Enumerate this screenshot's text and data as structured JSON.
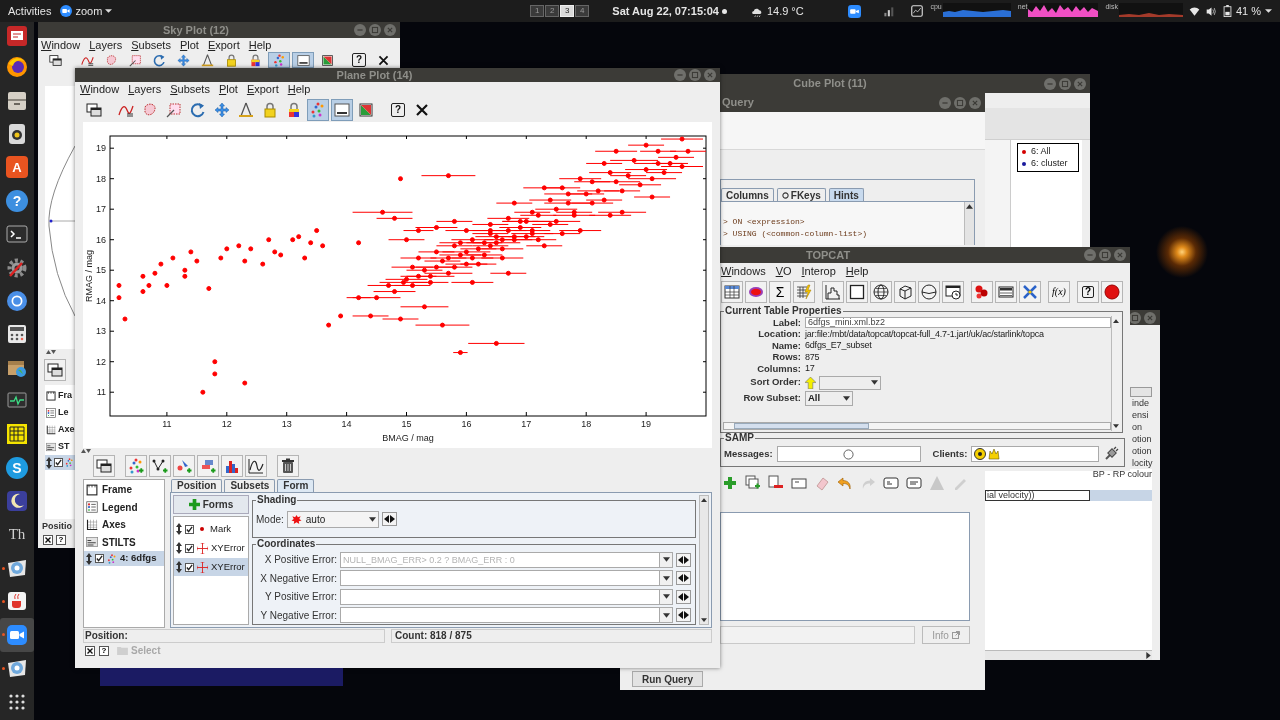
{
  "top_bar": {
    "activities": "Activities",
    "app_menu": "zoom",
    "workspaces": [
      {
        "label": "1",
        "selected": false
      },
      {
        "label": "2",
        "selected": false
      },
      {
        "label": "3",
        "selected": true
      },
      {
        "label": "4",
        "selected": false
      }
    ],
    "clock": "Sat Aug 22, 07:15:04",
    "weather": "14.9 °C",
    "monitors": [
      {
        "label": "cpu",
        "kind": "cpu"
      },
      {
        "label": "net",
        "kind": "net"
      },
      {
        "label": "disk",
        "kind": "disk"
      }
    ],
    "battery": "41 %"
  },
  "dock": {
    "items": [
      {
        "kind": "red-app",
        "running": false,
        "selected": false
      },
      {
        "kind": "browser",
        "running": false,
        "selected": false
      },
      {
        "kind": "files",
        "running": false,
        "selected": false
      },
      {
        "kind": "media",
        "running": false,
        "selected": false
      },
      {
        "kind": "store",
        "glyph": "A",
        "running": false,
        "selected": false
      },
      {
        "kind": "help",
        "glyph": "?",
        "running": false,
        "selected": false
      },
      {
        "kind": "terminal",
        "running": false,
        "selected": false
      },
      {
        "kind": "settings",
        "running": false,
        "selected": false
      },
      {
        "kind": "ring",
        "running": false,
        "selected": false
      },
      {
        "kind": "calculator",
        "running": false,
        "selected": false
      },
      {
        "kind": "package",
        "running": false,
        "selected": false
      },
      {
        "kind": "monitor",
        "running": false,
        "selected": false
      },
      {
        "kind": "grid",
        "running": false,
        "selected": false
      },
      {
        "kind": "chat",
        "glyph": "S",
        "running": false,
        "selected": false
      },
      {
        "kind": "night",
        "running": false,
        "selected": false
      },
      {
        "kind": "glyph",
        "glyph": "Th",
        "running": false,
        "selected": false
      },
      {
        "kind": "disc",
        "running": true,
        "selected": false
      },
      {
        "kind": "cup",
        "running": true,
        "selected": false
      },
      {
        "kind": "video",
        "running": true,
        "selected": true
      },
      {
        "kind": "disc",
        "running": true,
        "selected": false
      },
      {
        "kind": "apps",
        "running": false,
        "selected": false
      }
    ]
  },
  "cube_plot": {
    "title": "Cube Plot (11)",
    "legend": [
      {
        "label": "6: All",
        "color": "#d40000"
      },
      {
        "label": "6: cluster",
        "color": "#1a1a9c"
      }
    ]
  },
  "query_window": {
    "title": "Query",
    "tabs": [
      {
        "label": "Columns",
        "kind": "plain",
        "selected": false
      },
      {
        "label": "FKeys",
        "kind": "key",
        "selected": false
      },
      {
        "label": "Hints",
        "kind": "plain",
        "selected": true
      }
    ],
    "hints": [
      "> ON <expression>",
      "> USING (<common-column-list>)"
    ],
    "info_button": {
      "label": "Info",
      "disabled": true
    },
    "run_button": "Run Query"
  },
  "columns_window": {
    "cells": [
      "inde",
      "ensi",
      "on",
      "otion",
      "otion",
      "locity"
    ],
    "rows": [
      {
        "column_2": "BP - RP colour",
        "selected": false
      },
      {
        "column_1": "ial velocity))",
        "selected": true
      }
    ]
  },
  "topcat": {
    "title": "TOPCAT",
    "menu": [
      "Windows",
      "VO",
      "Interop",
      "Help"
    ],
    "toolbar": [
      {
        "kind": "table"
      },
      {
        "kind": "ellipse"
      },
      {
        "kind": "sigma",
        "glyph": "Σ"
      },
      {
        "kind": "tablebolt"
      },
      {
        "kind": "histogram"
      },
      {
        "kind": "plane"
      },
      {
        "kind": "globe"
      },
      {
        "kind": "cube"
      },
      {
        "kind": "sphere"
      },
      {
        "kind": "time"
      },
      {
        "kind": "balls"
      },
      {
        "kind": "select"
      },
      {
        "kind": "cross"
      },
      {
        "kind": "fx",
        "glyph": "f(x)"
      },
      {
        "kind": "help",
        "glyph": "?"
      },
      {
        "kind": "stop"
      }
    ],
    "properties": {
      "title": "Current Table Properties",
      "rows": [
        {
          "label": "Label:",
          "value": "6dfgs_mini.xml.bz2",
          "kind": "field"
        },
        {
          "label": "Location:",
          "value": "jar:file:/mbt/data/topcat/topcat-full_4.7-1.jar!/uk/ac/starlink/topca",
          "kind": "text"
        },
        {
          "label": "Name:",
          "value": "6dfgs_E7_subset",
          "kind": "text"
        },
        {
          "label": "Rows:",
          "value": "875",
          "kind": "text"
        },
        {
          "label": "Columns:",
          "value": "17",
          "kind": "text"
        },
        {
          "label": "Sort Order:",
          "kind": "sort"
        },
        {
          "label": "Row Subset:",
          "value": "All",
          "kind": "select"
        }
      ]
    },
    "samp": {
      "title": "SAMP",
      "messages_label": "Messages:",
      "clients_label": "Clients:"
    }
  },
  "sky_plot": {
    "title": "Sky Plot (12)",
    "menu": [
      "Window",
      "Layers",
      "Subsets",
      "Plot",
      "Export",
      "Help"
    ],
    "toolbar": [
      {
        "kind": "window",
        "pressed": false
      },
      {
        "kind": "curve",
        "pressed": false
      },
      {
        "kind": "blob",
        "pressed": false
      },
      {
        "kind": "zoombox",
        "pressed": false
      },
      {
        "kind": "refresh",
        "pressed": false
      },
      {
        "kind": "move",
        "pressed": false
      },
      {
        "kind": "compass",
        "pressed": false
      },
      {
        "kind": "lock",
        "pressed": false
      },
      {
        "kind": "lockc",
        "pressed": false
      },
      {
        "kind": "dots",
        "pressed": true
      },
      {
        "kind": "bar",
        "pressed": true
      },
      {
        "kind": "image",
        "pressed": false
      },
      {
        "kind": "help",
        "glyph": "?",
        "pressed": false
      },
      {
        "kind": "close",
        "pressed": false
      }
    ],
    "controls": [
      {
        "label": "Fra",
        "kind": "frame"
      },
      {
        "label": "Le",
        "kind": "legend"
      },
      {
        "label": "Axe",
        "kind": "axes"
      },
      {
        "label": "ST",
        "kind": "stilts"
      }
    ],
    "layer": {
      "checked": true,
      "selected": true
    },
    "status": "Positio"
  },
  "plane_plot": {
    "title": "Plane Plot (14)",
    "menu": [
      "Window",
      "Layers",
      "Subsets",
      "Plot",
      "Export",
      "Help"
    ],
    "toolbar": [
      {
        "kind": "window",
        "pressed": false
      },
      {
        "kind": "curve",
        "pressed": false
      },
      {
        "kind": "blob",
        "pressed": false
      },
      {
        "kind": "zoombox",
        "pressed": false
      },
      {
        "kind": "refresh",
        "pressed": false
      },
      {
        "kind": "move",
        "pressed": false
      },
      {
        "kind": "compass",
        "pressed": false
      },
      {
        "kind": "lock",
        "pressed": false
      },
      {
        "kind": "lockc",
        "pressed": false
      },
      {
        "kind": "dots",
        "pressed": true
      },
      {
        "kind": "bar",
        "pressed": true
      },
      {
        "kind": "image",
        "pressed": false
      },
      {
        "kind": "help",
        "glyph": "?",
        "pressed": false
      },
      {
        "kind": "close",
        "pressed": false
      }
    ],
    "chart_data": {
      "type": "scatter",
      "xlabel": "BMAG / mag",
      "ylabel": "RMAG / mag",
      "xlim": [
        10.05,
        20
      ],
      "ylim": [
        10.22,
        19.4
      ],
      "xticks": [
        11,
        12,
        13,
        14,
        15,
        16,
        17,
        18,
        19
      ],
      "yticks": [
        11,
        12,
        13,
        14,
        15,
        16,
        17,
        18,
        19
      ],
      "x": [
        10.2,
        10.3,
        10.2,
        10.6,
        10.7,
        10.6,
        10.9,
        11.0,
        11.3,
        11.3,
        11.5,
        11.7,
        11.9,
        12.2,
        12.0,
        12.4,
        12.7,
        12.9,
        13.1,
        13.3,
        13.5,
        13.7,
        13.9,
        14.2,
        13.6,
        12.3,
        11.8,
        11.8,
        11.6,
        12.3,
        11.4,
        12.8,
        10.8,
        11.1,
        13.2,
        12.6,
        13.4,
        14.9,
        15.7,
        15.9,
        16.5,
        15.6,
        14.4,
        14.2,
        14.6,
        14.8,
        15.2,
        15.0,
        14.5,
        14.7,
        14.95,
        15.2,
        15.5,
        15.7,
        16.0,
        16.3,
        16.5,
        16.7,
        17.0,
        17.2,
        17.5,
        17.7,
        18.0,
        18.2,
        18.5,
        18.7,
        19.0,
        19.2,
        19.5,
        19.6,
        19.4,
        19.1,
        18.6,
        18.1,
        17.8,
        17.5,
        17.1,
        16.8,
        16.4,
        16.1,
        15.8,
        15.4,
        15.1,
        14.8,
        16.4,
        16.7,
        17.1,
        17.4,
        17.7,
        18.1,
        18.4,
        18.8,
        19.2,
        17.9,
        17.0,
        16.6,
        16.3,
        16.0,
        15.7,
        15.4,
        15.1,
        16.2,
        16.0,
        17.3,
        17.9,
        18.6,
        19.1,
        19.6,
        16.9,
        16.4,
        15.9,
        15.5,
        15.2,
        15.5,
        15.8,
        16.8,
        17.3,
        18.3,
        16.6,
        17.2,
        15.3,
        14.9,
        16.1,
        16.7,
        17.6,
        18.4,
        15.6,
        15.9,
        16.2,
        16.5,
        16.8,
        17.1,
        17.4,
        15.8,
        16.1,
        16.4,
        16.9,
        15.3,
        15.0,
        16.6,
        17.8,
        18.3,
        18.9,
        19.3,
        19.7,
        17.6,
        18.5,
        19.0
      ],
      "series": [
        {
          "color": "#ff0000",
          "values": [
            14.5,
            13.4,
            14.1,
            14.8,
            14.5,
            14.3,
            15.2,
            14.5,
            15.0,
            14.8,
            15.3,
            14.4,
            15.4,
            15.8,
            15.7,
            15.7,
            16.0,
            15.5,
            16.0,
            15.4,
            16.3,
            13.2,
            13.5,
            15.9,
            15.8,
            15.3,
            12.0,
            11.6,
            11.0,
            11.3,
            15.6,
            15.6,
            14.9,
            15.4,
            16.1,
            15.2,
            15.9,
            18.0,
            18.1,
            12.3,
            12.6,
            13.2,
            13.5,
            14.1,
            16.9,
            16.7,
            16.3,
            16.0,
            14.1,
            14.5,
            14.6,
            14.8,
            15.1,
            15.4,
            15.6,
            15.9,
            16.1,
            16.3,
            16.6,
            16.8,
            17.0,
            17.2,
            17.5,
            17.6,
            17.9,
            18.1,
            18.3,
            18.5,
            18.7,
            19.3,
            18.5,
            18.0,
            17.6,
            17.2,
            16.9,
            16.6,
            16.3,
            16.1,
            15.8,
            15.4,
            15.1,
            14.8,
            14.5,
            14.3,
            16.5,
            16.7,
            16.9,
            17.3,
            17.5,
            17.9,
            18.2,
            18.6,
            18.9,
            18.0,
            16.1,
            15.7,
            15.5,
            15.2,
            14.9,
            14.6,
            15.1,
            15.2,
            16.3,
            15.8,
            16.3,
            16.9,
            17.4,
            18.4,
            16.6,
            16.2,
            15.9,
            15.6,
            15.4,
            16.4,
            16.6,
            17.2,
            17.7,
            18.5,
            15.4,
            16.0,
            13.8,
            13.4,
            14.6,
            14.9,
            16.2,
            16.8,
            15.3,
            15.5,
            15.7,
            15.9,
            16.0,
            16.2,
            16.5,
            15.8,
            16.0,
            16.3,
            16.4,
            15.0,
            14.7,
            16.0,
            16.8,
            17.3,
            17.8,
            18.2,
            18.9,
            17.7,
            18.9,
            19.1
          ],
          "xerrors": [
            0,
            0,
            0,
            0,
            0,
            0,
            0,
            0,
            0,
            0,
            0,
            0,
            0,
            0,
            0,
            0,
            0,
            0,
            0,
            0,
            0,
            0,
            0,
            0,
            0,
            0,
            0,
            0,
            0,
            0,
            0,
            0,
            0,
            0,
            0,
            0,
            0,
            0,
            0.45,
            0.12,
            0.47,
            0.45,
            0.3,
            0.2,
            0.5,
            0.3,
            0.25,
            0.3,
            0.4,
            0.35,
            0.4,
            0.3,
            0.35,
            0.3,
            0.4,
            0.3,
            0.35,
            0.3,
            0.4,
            0.3,
            0.35,
            0.4,
            0.3,
            0.35,
            0.4,
            0.3,
            0.35,
            0.4,
            0.3,
            0.35,
            0.3,
            0.4,
            0.3,
            0.35,
            0.3,
            0.4,
            0.3,
            0.35,
            0.3,
            0.35,
            0.3,
            0.4,
            0.3,
            0.35,
            0.3,
            0.35,
            0.3,
            0.35,
            0.4,
            0.3,
            0.35,
            0.4,
            0.3,
            0.35,
            0.3,
            0.35,
            0.3,
            0.35,
            0.4,
            0.3,
            0.35,
            0.3,
            0.35,
            0.3,
            0.35,
            0.4,
            0.3,
            0.35,
            0.3,
            0.3,
            0.35,
            0.3,
            0.3,
            0.35,
            0.3,
            0.3,
            0.35,
            0.3,
            0.35,
            0.3,
            0.4,
            0.3,
            0.35,
            0.3,
            0.3,
            0.35,
            0.3,
            0.35,
            0.3,
            0.4,
            0.3,
            0.35,
            0.3,
            0.3,
            0.35,
            0.3,
            0.35,
            0.3,
            0.35,
            0.3,
            0.35,
            0.3,
            0.35,
            0.3,
            0.3,
            0.3,
            0.35,
            0.3
          ]
        }
      ]
    },
    "controls": [
      {
        "label": "Frame",
        "kind": "frame"
      },
      {
        "label": "Legend",
        "kind": "legend"
      },
      {
        "label": "Axes",
        "kind": "axes"
      },
      {
        "label": "STILTS",
        "kind": "stilts"
      }
    ],
    "layers": [
      {
        "label": "4: 6dfgs",
        "checked": true,
        "selected": true
      }
    ],
    "tabs": [
      {
        "label": "Position",
        "selected": false
      },
      {
        "label": "Subsets",
        "selected": false
      },
      {
        "label": "Form",
        "selected": true
      }
    ],
    "forms_button": "Forms",
    "forms": [
      {
        "label": "Mark",
        "kind": "mark",
        "checked": true,
        "selected": false
      },
      {
        "label": "XYError",
        "kind": "error",
        "checked": true,
        "selected": false
      },
      {
        "label": "XYError",
        "kind": "error",
        "checked": true,
        "selected": true
      }
    ],
    "shading": {
      "title": "Shading",
      "mode_label": "Mode:",
      "mode": "auto"
    },
    "coordinates": {
      "title": "Coordinates",
      "fields": [
        {
          "label": "X Positive Error:",
          "placeholder": "NULL_BMAG_ERR> 0.2 ? BMAG_ERR : 0"
        },
        {
          "label": "X Negative Error:"
        },
        {
          "label": "Y Positive Error:"
        },
        {
          "label": "Y Negative Error:"
        }
      ]
    },
    "position_label": "Position:",
    "count": "Count: 818 / 875",
    "help_glyph": "?",
    "select": {
      "label": "Select",
      "disabled": true
    }
  }
}
